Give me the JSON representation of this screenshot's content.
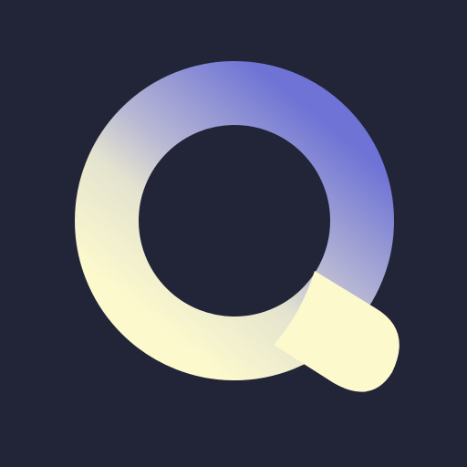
{
  "icon": {
    "name": "magnifier-q-logo-icon",
    "colors": {
      "background": "#222438",
      "ring_gradient_start": "#FCF9CD",
      "ring_gradient_mid": "#D6D7D6",
      "ring_gradient_end": "#6E73D5",
      "handle": "#FCF9CD"
    }
  }
}
